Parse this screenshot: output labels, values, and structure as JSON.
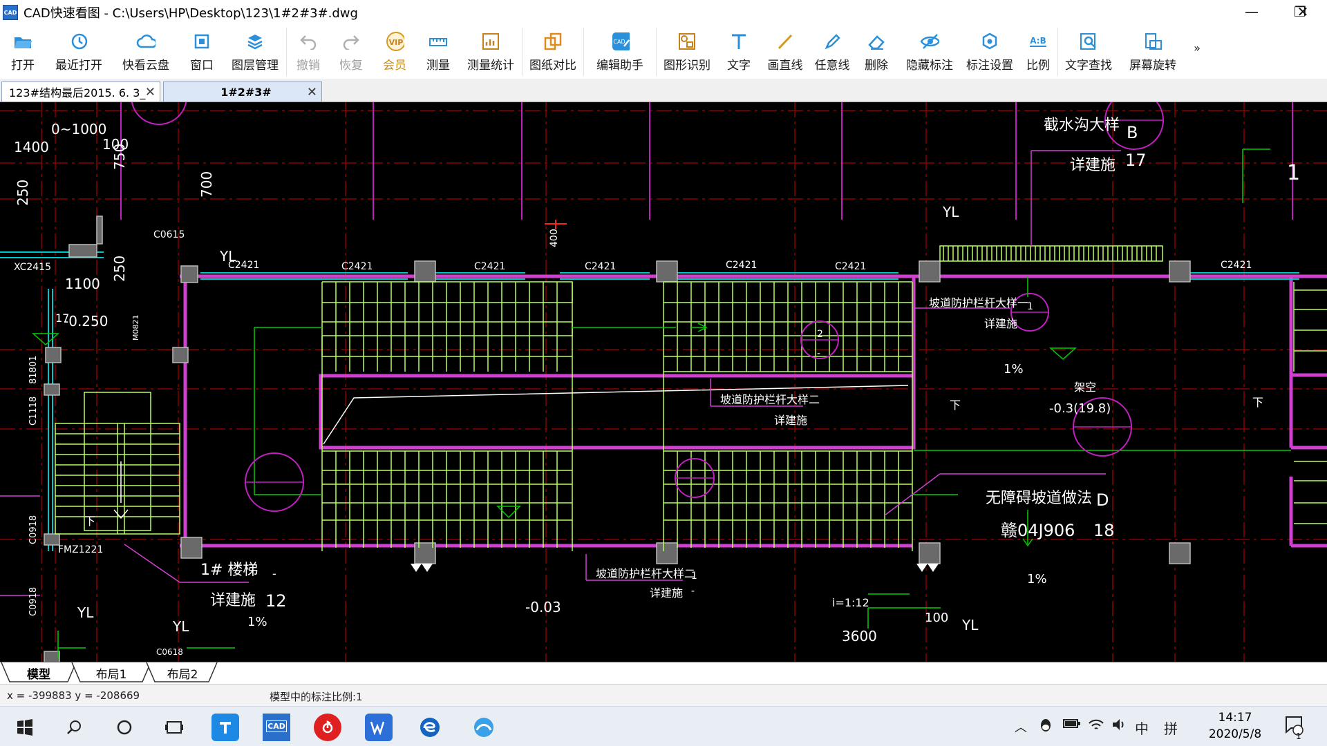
{
  "window": {
    "title": "CAD快速看图 - C:\\Users\\HP\\Desktop\\123\\1#2#3#.dwg",
    "app_icon": "CAD",
    "controls": {
      "minimize": "—",
      "maximize": "❐",
      "close": "✕"
    }
  },
  "toolbar": {
    "open": "打开",
    "recent": "最近打开",
    "cloud": "快看云盘",
    "window": "窗口",
    "layers": "图层管理",
    "undo": "撤销",
    "redo": "恢复",
    "vip": "会员",
    "vip_badge": "VIP",
    "measure": "测量",
    "measure_stats": "测量统计",
    "compare": "图纸对比",
    "edit_assistant": "编辑助手",
    "shape_recognition": "图形识别",
    "text": "文字",
    "line": "画直线",
    "freeline": "任意线",
    "delete": "删除",
    "hide_dims": "隐藏标注",
    "dim_settings": "标注设置",
    "scale": "比例",
    "scale_icon": "A:B",
    "text_search": "文字查找",
    "screen_rotate": "屏幕旋转",
    "more": "»"
  },
  "doc_tabs": [
    {
      "label": "123#结构最后2015. 6. 3_"
    },
    {
      "label": "1#2#3#"
    }
  ],
  "layout_tabs": [
    "模型",
    "布局1",
    "布局2"
  ],
  "status": {
    "coords": "x = -399883  y = -208669",
    "scale_text": "模型中的标注比例:1"
  },
  "taskbar": {
    "time": "14:17",
    "date": "2020/5/8",
    "ime_lang": "中",
    "ime_mode": "拼",
    "notif_count": "1"
  },
  "drawing": {
    "xiangjianshi": "详建施",
    "n12": "12",
    "n17": "17",
    "B": "B",
    "D": "D",
    "n18": "18",
    "n1": "1",
    "n2": "2",
    "dash": "-",
    "dim_0_1000": "0~1000",
    "dim_1400": "1400",
    "dim_100": "100",
    "dim_750": "750",
    "dim_250": "250",
    "dim_700": "700",
    "c0615": "C0615",
    "xc2415": "XC2415",
    "dim_1100": "1100",
    "dim_400": "400",
    "c2421": "C2421",
    "yl": "YL",
    "n17b": "17",
    "neg250": "-0.250",
    "m0821": "M0821",
    "c1118": "C1118",
    "c0918": "C0918",
    "d1808": "81801",
    "fmz1221": "FMZ1221",
    "stair": "1# 楼梯",
    "xia": "下",
    "jiezhigou": "截水沟大样",
    "ramp_rail_1": "坡道防护栏杆大样一",
    "ramp_rail_2": "坡道防护栏杆大样二",
    "pct1": "1%",
    "jiakong": "架空",
    "elev_03": "-0.3(19.8)",
    "wuzhangai": "无障碍坡道做法",
    "gan": "赣04J906",
    "elev_003": "-0.03",
    "slope": "i=1:12",
    "dim_3600": "3600",
    "c0618": "C0618",
    "one": "1"
  },
  "colors": {
    "canvas_bg": "#000000",
    "magenta": "#e020e0",
    "green": "#00e000",
    "darkred": "#8a0000",
    "lightgreen": "#b8ff60",
    "white": "#ffffff",
    "grey": "#9a9a9a",
    "cyan": "#00d0d0"
  }
}
